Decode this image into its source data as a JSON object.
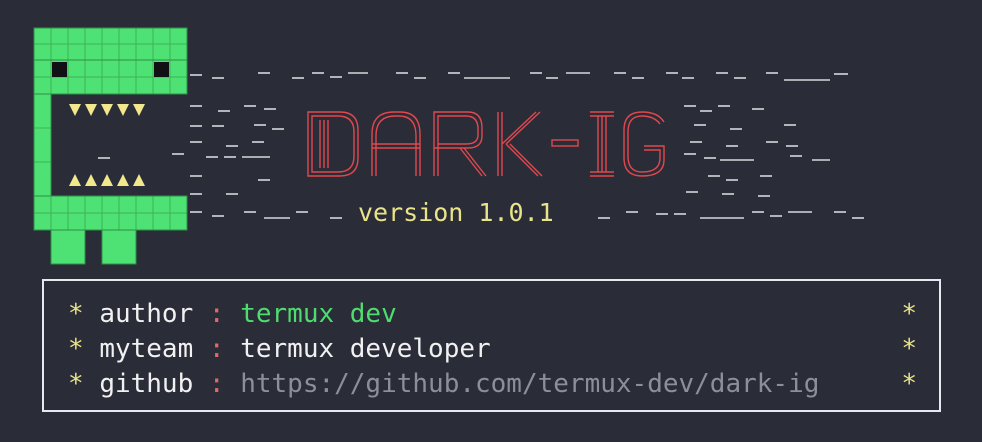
{
  "banner": {
    "logo_text": "DARK-IG",
    "version_text": "version 1.0.1"
  },
  "info": {
    "rows": [
      {
        "star": "*",
        "label": "author",
        "sep": ":",
        "value": "termux dev",
        "end_star": "*"
      },
      {
        "star": "*",
        "label": "myteam",
        "sep": ":",
        "value": "termux developer",
        "end_star": "*"
      },
      {
        "star": "*",
        "label": "github",
        "sep": ":",
        "value": "https://github.com/termux-dev/dark-ig",
        "end_star": "*"
      }
    ]
  },
  "colors": {
    "background": "#2a2c38",
    "mascot_green": "#4ee173",
    "mascot_teeth": "#f0e88a",
    "logo_red": "#e0484e",
    "version_yellow": "#e9e38a",
    "value_green": "#4fdc6e",
    "link_grey": "#8c8f9a",
    "border": "#e8e8ee"
  }
}
